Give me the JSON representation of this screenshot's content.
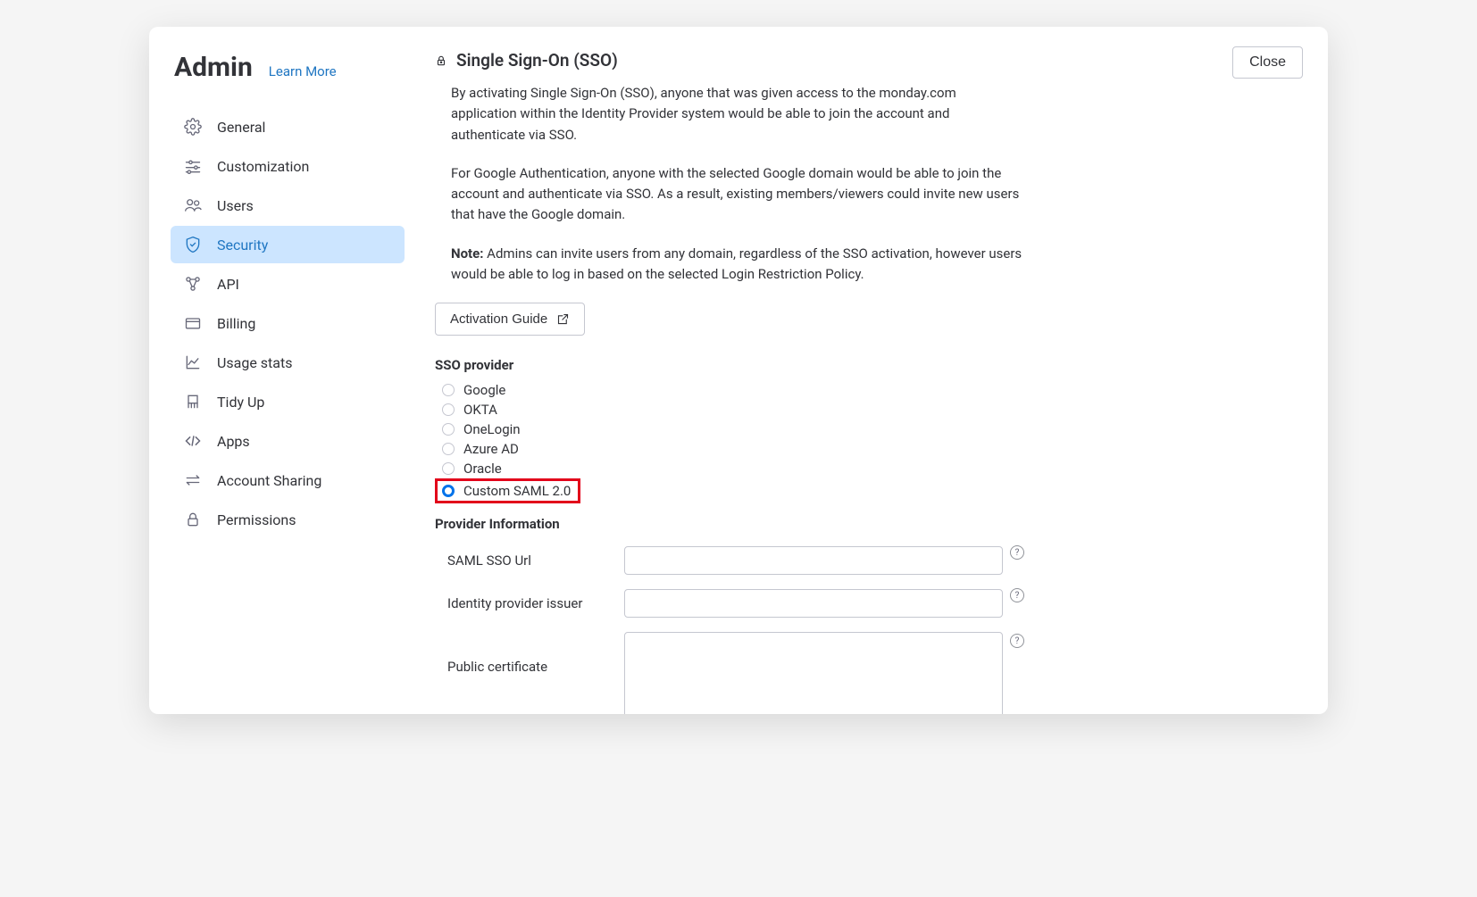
{
  "sidebar": {
    "title": "Admin",
    "learn_more": "Learn More",
    "items": [
      {
        "label": "General"
      },
      {
        "label": "Customization"
      },
      {
        "label": "Users"
      },
      {
        "label": "Security"
      },
      {
        "label": "API"
      },
      {
        "label": "Billing"
      },
      {
        "label": "Usage stats"
      },
      {
        "label": "Tidy Up"
      },
      {
        "label": "Apps"
      },
      {
        "label": "Account Sharing"
      },
      {
        "label": "Permissions"
      }
    ]
  },
  "main": {
    "close_label": "Close",
    "heading": "Single Sign-On (SSO)",
    "para1": "By activating Single Sign-On (SSO), anyone that was given access to the monday.com application within the Identity Provider system would be able to join the account and authenticate via SSO.",
    "para2": "For Google Authentication, anyone with the selected Google domain would be able to join the account and authenticate via SSO. As a result, existing members/viewers could invite new users that have the Google domain.",
    "note_label": "Note:",
    "note_text": " Admins can invite users from any domain, regardless of the SSO activation, however users would be able to log in based on the selected Login Restriction Policy.",
    "activation_guide_label": "Activation Guide",
    "sso_provider_label": "SSO provider",
    "providers": [
      {
        "label": "Google",
        "selected": false,
        "highlighted": false
      },
      {
        "label": "OKTA",
        "selected": false,
        "highlighted": false
      },
      {
        "label": "OneLogin",
        "selected": false,
        "highlighted": false
      },
      {
        "label": "Azure AD",
        "selected": false,
        "highlighted": false
      },
      {
        "label": "Oracle",
        "selected": false,
        "highlighted": false
      },
      {
        "label": "Custom SAML 2.0",
        "selected": true,
        "highlighted": true
      }
    ],
    "provider_info_label": "Provider Information",
    "fields": {
      "saml_url_label": "SAML SSO Url",
      "saml_url_value": "",
      "idp_issuer_label": "Identity provider issuer",
      "idp_issuer_value": "",
      "public_cert_label": "Public certificate",
      "public_cert_value": ""
    }
  }
}
